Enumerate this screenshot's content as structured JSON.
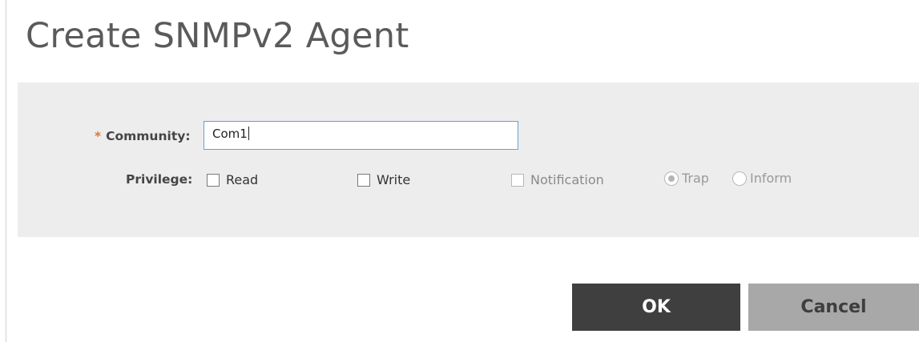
{
  "dialog": {
    "title": "Create SNMPv2 Agent"
  },
  "form": {
    "community": {
      "required_marker": "*",
      "label": "Community:",
      "value": "Com1"
    },
    "privilege": {
      "label": "Privilege:",
      "options": [
        {
          "label": "Read",
          "checked": false,
          "enabled": true
        },
        {
          "label": "Write",
          "checked": false,
          "enabled": true
        },
        {
          "label": "Notification",
          "checked": false,
          "enabled": false
        }
      ],
      "notification_type": {
        "options": [
          {
            "label": "Trap",
            "selected": true,
            "enabled": false
          },
          {
            "label": "Inform",
            "selected": false,
            "enabled": false
          }
        ]
      }
    }
  },
  "actions": {
    "ok_label": "OK",
    "cancel_label": "Cancel"
  },
  "colors": {
    "required_marker": "#e8742c",
    "panel_background": "#ededed",
    "ok_button": "#3f3f3f",
    "cancel_button": "#a8a8a8",
    "input_border": "#6a9fd0"
  }
}
